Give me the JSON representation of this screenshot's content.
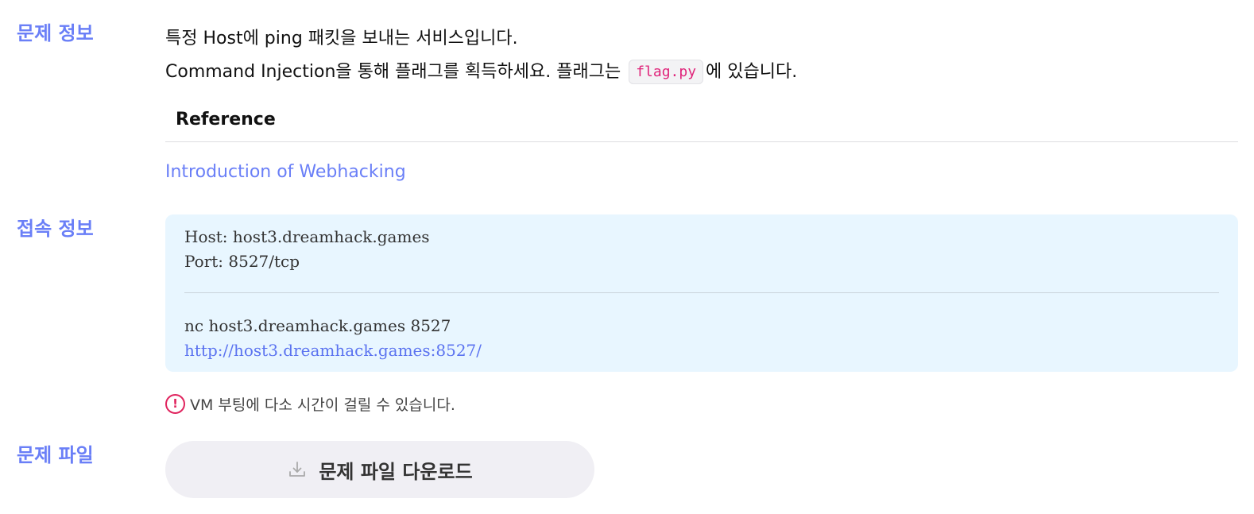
{
  "sections": {
    "info_label": "문제 정보",
    "connection_label": "접속 정보",
    "file_label": "문제 파일"
  },
  "description": {
    "line1": "특정 Host에 ping 패킷을 보내는 서비스입니다.",
    "line2_before": "Command Injection을 통해 플래그를 획득하세요. 플래그는 ",
    "line2_code": "flag.py",
    "line2_after": "에 있습니다."
  },
  "reference": {
    "heading": "Reference",
    "link_text": "Introduction of Webhacking"
  },
  "connection": {
    "host": "Host: host3.dreamhack.games",
    "port": "Port: 8527/tcp",
    "nc_command": "nc host3.dreamhack.games 8527",
    "url": "http://host3.dreamhack.games:8527/"
  },
  "notice": {
    "icon": "exclamation-circle-icon",
    "text": "VM 부팅에 다소 시간이 걸릴 수 있습니다."
  },
  "download": {
    "icon": "download-icon",
    "label": "문제 파일 다운로드"
  },
  "colors": {
    "accent": "#6a7ff7",
    "link": "#5b73f0",
    "code": "#e0247a",
    "notice_icon": "#e0245e",
    "connection_bg": "#e8f6ff",
    "button_bg": "#f0eff4"
  }
}
